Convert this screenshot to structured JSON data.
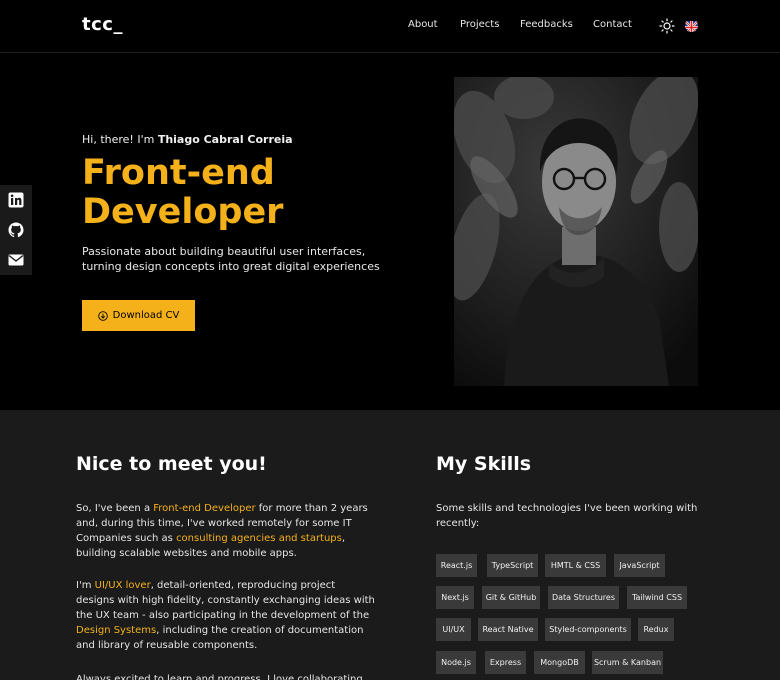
{
  "header": {
    "logo": "tcc_",
    "nav": [
      {
        "label": "About"
      },
      {
        "label": "Projects"
      },
      {
        "label": "Feedbacks"
      },
      {
        "label": "Contact"
      }
    ],
    "theme_icon": "sun-icon",
    "language_icon": "uk-flag-icon"
  },
  "hero": {
    "greeting_prefix": "Hi, there! I'm",
    "name": "Thiago Cabral Correia",
    "title_line1": "Front-end",
    "title_line2": "Developer",
    "description": "Passionate about building beautiful user interfaces, turning design concepts into great digital experiences",
    "cv_button": "Download CV",
    "accent": "#f5b119"
  },
  "social": [
    {
      "icon": "linkedin-icon"
    },
    {
      "icon": "github-icon"
    },
    {
      "icon": "mail-icon"
    }
  ],
  "about": {
    "title": "Nice to meet you!",
    "p1": {
      "a": "So, I've been a ",
      "b": "Front-end Developer",
      "c": " for more than 2 years and, during this time, I've worked remotely for some IT Companies such as ",
      "d": "consulting agencies and startups",
      "e": ", building scalable websites and mobile apps."
    },
    "p2": {
      "a": "I'm ",
      "b": "UI/UX lover",
      "c": ", detail-oriented, reproducing project designs with high fidelity, constantly exchanging ideas with the UX team - also participating in the development of the ",
      "d": "Design Systems",
      "e": ", including the creation of documentation and library of reusable components."
    },
    "p3": "Always excited to learn and progress. I love collaborating"
  },
  "skills": {
    "title": "My Skills",
    "intro": "Some skills and technologies I've been working with recently:",
    "items": [
      "React.js",
      "TypeScript",
      "HMTL & CSS",
      "JavaScript",
      "Next.js",
      "Git & GitHub",
      "Data Structures",
      "Tailwind CSS",
      "UI/UX",
      "React Native",
      "Styled-components",
      "Redux",
      "Node.js",
      "Express",
      "MongoDB",
      "Scrum & Kanban"
    ]
  }
}
